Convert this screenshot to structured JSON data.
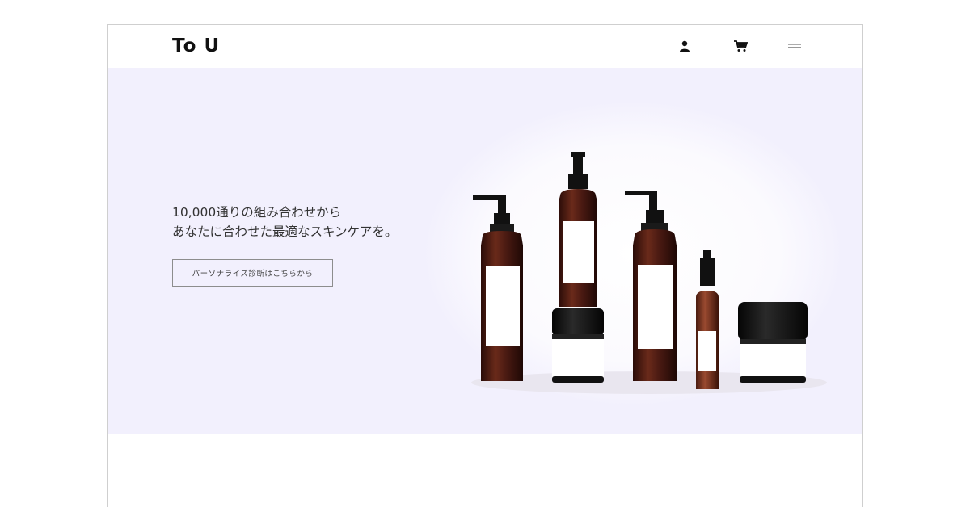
{
  "header": {
    "logo": "To U",
    "icons": [
      "account-icon",
      "cart-icon",
      "menu-icon"
    ]
  },
  "hero": {
    "tagline": [
      "10,000通りの組み合わせから",
      "あなたに合わせた最適なスキンケアを。"
    ],
    "cta_label": "パーソナライズ診断はこちらから",
    "background_color": "#f2f0fd"
  },
  "colors": {
    "bottle": "#4a1a12",
    "cap": "#111111",
    "label": "#ffffff",
    "text": "#333333"
  }
}
